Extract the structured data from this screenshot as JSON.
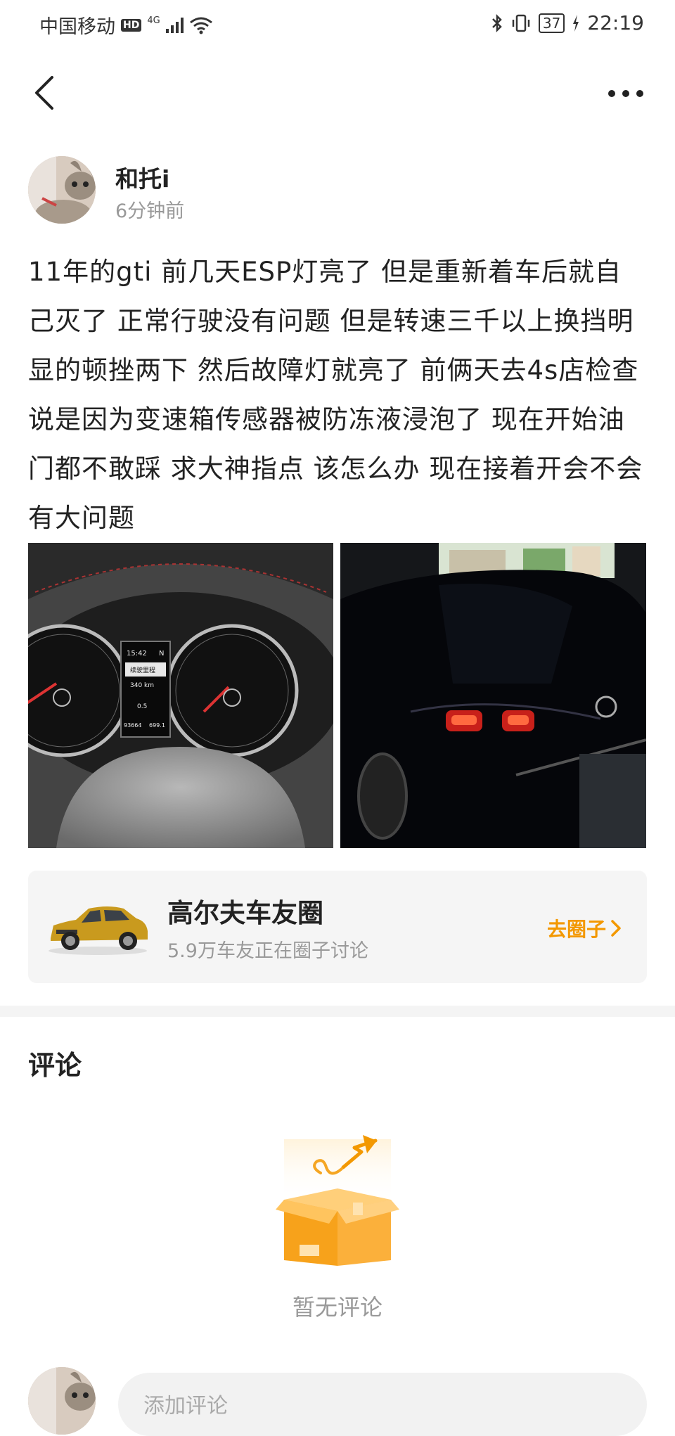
{
  "status_bar": {
    "carrier": "中国移动",
    "hd": "HD",
    "network": "4G",
    "battery": "37",
    "time": "22:19"
  },
  "post": {
    "author": "和托i",
    "time_ago": "6分钟前",
    "content": "11年的gti  前几天ESP灯亮了 但是重新着车后就自己灭了  正常行驶没有问题  但是转速三千以上换挡明显的顿挫两下  然后故障灯就亮了  前俩天去4s店检查说是因为变速箱传感器被防冻液浸泡了  现在开始油门都不敢踩   求大神指点  该怎么办 现在接着开会不会有大问题",
    "dashboard": {
      "clock": "15:42",
      "gear": "N",
      "label": "续驶里程",
      "range": "340 km",
      "temp": "0.5",
      "odometer": "93664",
      "trip": "699.1"
    }
  },
  "circle": {
    "name": "高尔夫车友圈",
    "subtitle": "5.9万车友正在圈子讨论",
    "action": "去圈子"
  },
  "comments": {
    "title": "评论",
    "empty_text": "暂无评论",
    "input_placeholder": "添加评论"
  },
  "colors": {
    "accent": "#f39800",
    "muted_text": "#999999",
    "card_bg": "#f5f5f5"
  },
  "icons": {
    "back": "chevron-left-icon",
    "more": "more-dots-icon",
    "go": "chevron-right-icon",
    "empty": "empty-box-icon"
  }
}
